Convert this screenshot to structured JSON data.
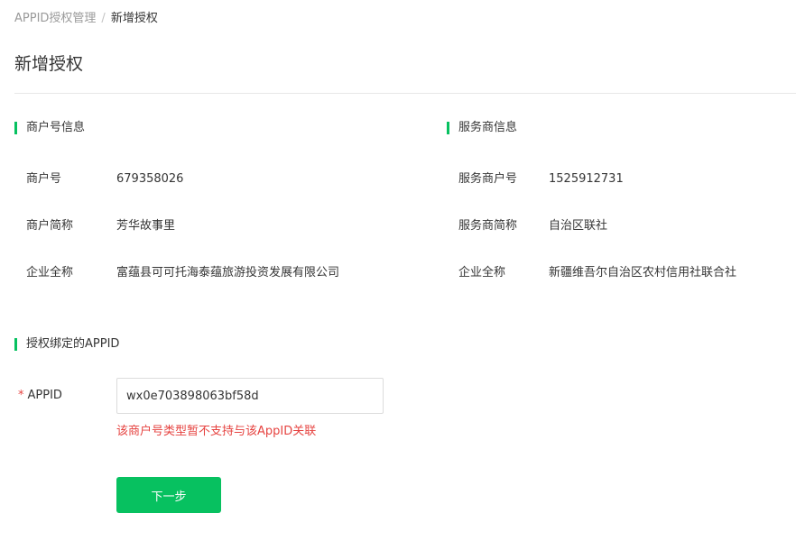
{
  "breadcrumb": {
    "parent": "APPID授权管理",
    "separator": "/",
    "current": "新增授权"
  },
  "page_title": "新增授权",
  "merchant_info": {
    "title": "商户号信息",
    "fields": [
      {
        "label": "商户号",
        "value": "679358026"
      },
      {
        "label": "商户简称",
        "value": "芳华故事里"
      },
      {
        "label": "企业全称",
        "value": "富蕴县可可托海泰蕴旅游投资发展有限公司"
      }
    ]
  },
  "provider_info": {
    "title": "服务商信息",
    "fields": [
      {
        "label": "服务商户号",
        "value": "1525912731"
      },
      {
        "label": "服务商简称",
        "value": "自治区联社"
      },
      {
        "label": "企业全称",
        "value": "新疆维吾尔自治区农村信用社联合社"
      }
    ]
  },
  "appid_section": {
    "title": "授权绑定的APPID",
    "required_mark": "*",
    "label": "APPID",
    "input_value": "wx0e703898063bf58d",
    "error": "该商户号类型暂不支持与该AppID关联"
  },
  "next_button": "下一步",
  "colors": {
    "accent": "#07c160",
    "error": "#e64340"
  }
}
